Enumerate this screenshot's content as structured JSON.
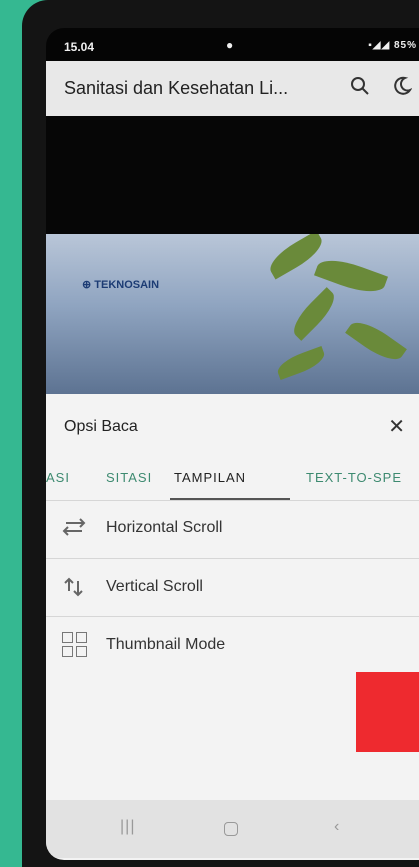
{
  "status_bar": {
    "time": "15.04",
    "right_text": "85%",
    "notification_icons": [
      "whatsapp-icon",
      "instagram-icon",
      "lock-icon"
    ],
    "system_icons": [
      "battery-saver-icon",
      "mute-icon",
      "wifi-icon",
      "signal-icon",
      "signal-icon",
      "battery-icon"
    ]
  },
  "app_bar": {
    "title": "Sanitasi dan Kesehatan Li...",
    "icons": [
      "search-icon",
      "theme-icon"
    ]
  },
  "cover": {
    "brand": "TEKNOSAIN"
  },
  "sheet": {
    "title": "Opsi Baca",
    "tabs": [
      {
        "label": "TASI"
      },
      {
        "label": "SITASI"
      },
      {
        "label": "TAMPILAN",
        "selected": true
      },
      {
        "label": "TEXT-TO-SPE"
      }
    ],
    "options": [
      {
        "icon": "horizontal-scroll-icon",
        "label": "Horizontal Scroll"
      },
      {
        "icon": "vertical-scroll-icon",
        "label": "Vertical Scroll"
      },
      {
        "icon": "thumbnail-grid-icon",
        "label": "Thumbnail Mode"
      }
    ]
  },
  "nav_bar": {
    "buttons": [
      "recents-button",
      "home-button",
      "back-button"
    ]
  },
  "colors": {
    "background": "#35b891",
    "accent_tab": "#3d8a70",
    "sheet": "#f3f3f3",
    "red_overlay": "#ee2a2f"
  }
}
